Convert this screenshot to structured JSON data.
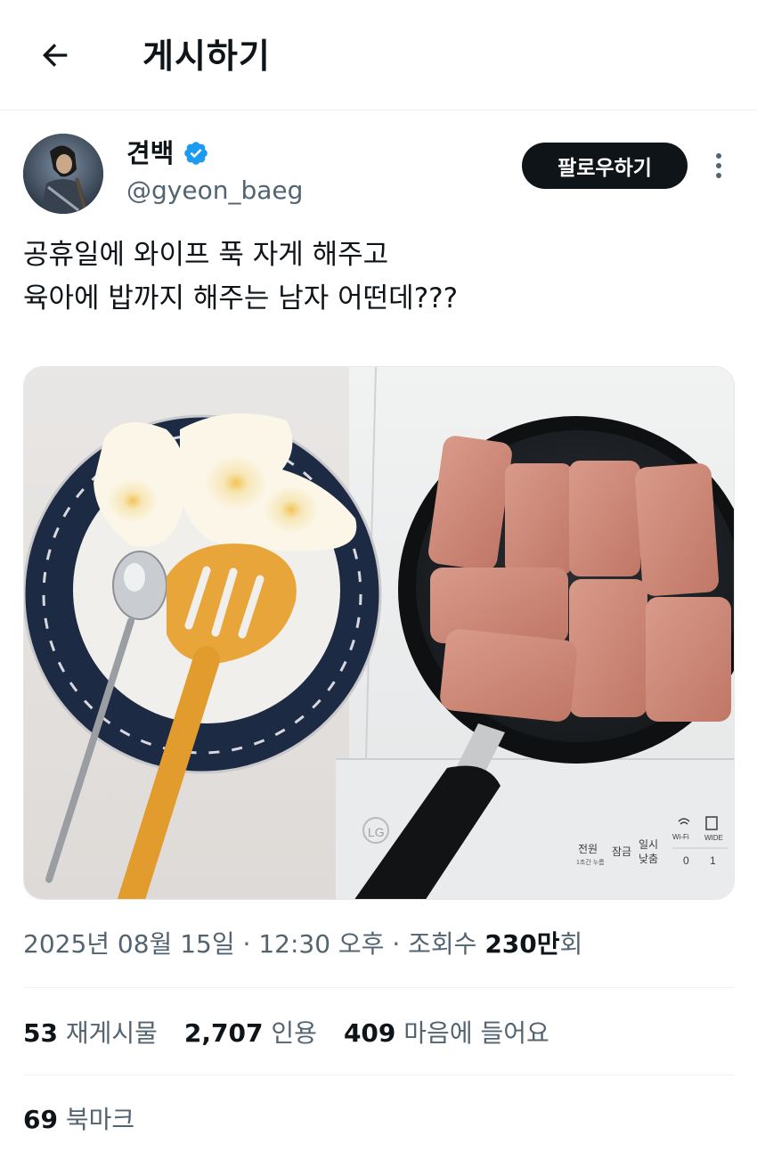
{
  "header": {
    "title": "게시하기",
    "back_icon": "arrow-left-icon"
  },
  "author": {
    "display_name": "견백",
    "handle": "@gyeon_baeg",
    "verified_color": "#1d9bf0"
  },
  "actions": {
    "follow_label": "팔로우하기"
  },
  "tweet": {
    "lines": [
      "공휴일에 와이프 푹 자게 해주고",
      "육아에 밥까지 해주는 남자 어떤데???"
    ]
  },
  "media": {
    "stove_labels": {
      "power": "전원",
      "power_sub": "1초간 누름",
      "lock": "잠금",
      "pause": "일시",
      "pause2": "낮춤",
      "wifi": "Wi-Fi",
      "wide": "WIDE",
      "zero": "0",
      "one": "1",
      "brand": "LG"
    }
  },
  "meta": {
    "date": "2025년 08월 15일",
    "sep1": " · ",
    "time": "12:30 오후",
    "sep2": " · ",
    "views_label": "조회수 ",
    "views_value": "230만",
    "views_suffix": "회"
  },
  "stats": {
    "reposts_count": "53",
    "reposts_label": "재게시물",
    "quotes_count": "2,707",
    "quotes_label": "인용",
    "likes_count": "409",
    "likes_label": "마음에 들어요",
    "bookmarks_count": "69",
    "bookmarks_label": "북마크"
  }
}
